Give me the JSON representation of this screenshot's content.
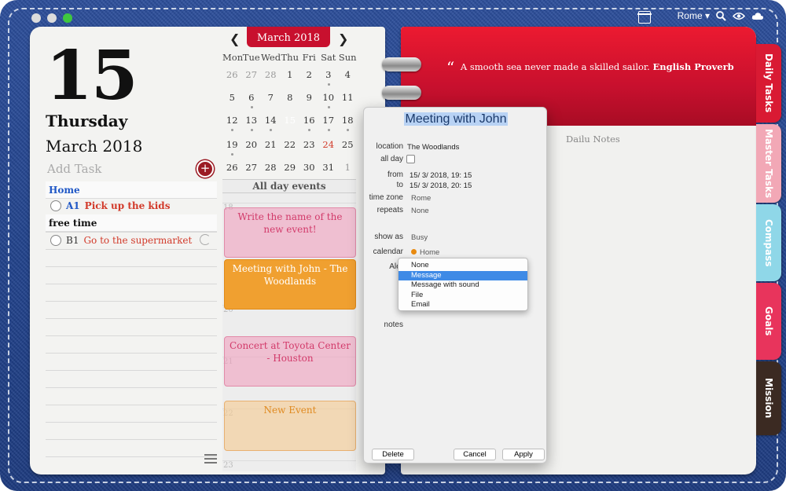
{
  "window": {
    "location": "Rome ▾",
    "colors": {
      "denim": "#22448e",
      "accent_red": "#c8102e",
      "selection": "#3e8ae6"
    }
  },
  "left_page": {
    "day_number": "15",
    "day_name": "Thursday",
    "month_year": "March 2018",
    "add_task_placeholder": "Add Task",
    "add_task_icon": "+",
    "task_groups": [
      {
        "title": "Home",
        "tasks": [
          {
            "code": "A1",
            "text": "Pick up the kids"
          }
        ]
      },
      {
        "title": "free time",
        "tasks": [
          {
            "code": "B1",
            "text": "Go to the supermarket"
          }
        ]
      }
    ]
  },
  "mini_calendar": {
    "month_label": "March 2018",
    "prev": "❮",
    "next": "❯",
    "weekdays": [
      "Mon",
      "Tue",
      "Wed",
      "Thu",
      "Fri",
      "Sat",
      "Sun"
    ],
    "weeks": [
      [
        "26",
        "27",
        "28",
        "1",
        "2",
        "3",
        "4"
      ],
      [
        "5",
        "6",
        "7",
        "8",
        "9",
        "10",
        "11"
      ],
      [
        "12",
        "13",
        "14",
        "15",
        "16",
        "17",
        "18"
      ],
      [
        "19",
        "20",
        "21",
        "22",
        "23",
        "24",
        "25"
      ],
      [
        "26",
        "27",
        "28",
        "29",
        "30",
        "31",
        "1"
      ]
    ]
  },
  "day_view": {
    "all_day_label": "All day events",
    "hours": [
      "18",
      "20",
      "21",
      "22",
      "23"
    ],
    "events": [
      {
        "title": "Write the name of the new event!"
      },
      {
        "title": "Meeting with John - The Woodlands"
      },
      {
        "title": "Concert at Toyota Center - Houston"
      },
      {
        "title": "New Event"
      }
    ]
  },
  "right_page": {
    "quote_mark": "“",
    "quote": "A smooth sea never made a skilled sailor.",
    "quote_source": "English Proverb",
    "notes_title": "Dailu Notes",
    "tabs": [
      "Daily Tasks",
      "Master Tasks",
      "Compass",
      "Goals",
      "Mission"
    ]
  },
  "event_editor": {
    "title": "Meeting with John",
    "fields": {
      "location_label": "location",
      "location": "The Woodlands",
      "allday_label": "all day",
      "from_label": "from",
      "from": "15/ 3/ 2018,  19: 15",
      "to_label": "to",
      "to": "15/ 3/ 2018,  20: 15",
      "timezone_label": "time zone",
      "timezone": "Rome",
      "repeats_label": "repeats",
      "repeats": "None",
      "showas_label": "show as",
      "showas": "Busy",
      "calendar_label": "calendar",
      "calendar": "Home",
      "alert_label": "Aler",
      "notes_label": "notes"
    },
    "alert_options": [
      "None",
      "Message",
      "Message with sound",
      "File",
      "Email"
    ],
    "buttons": {
      "delete": "Delete",
      "cancel": "Cancel",
      "apply": "Apply"
    }
  }
}
